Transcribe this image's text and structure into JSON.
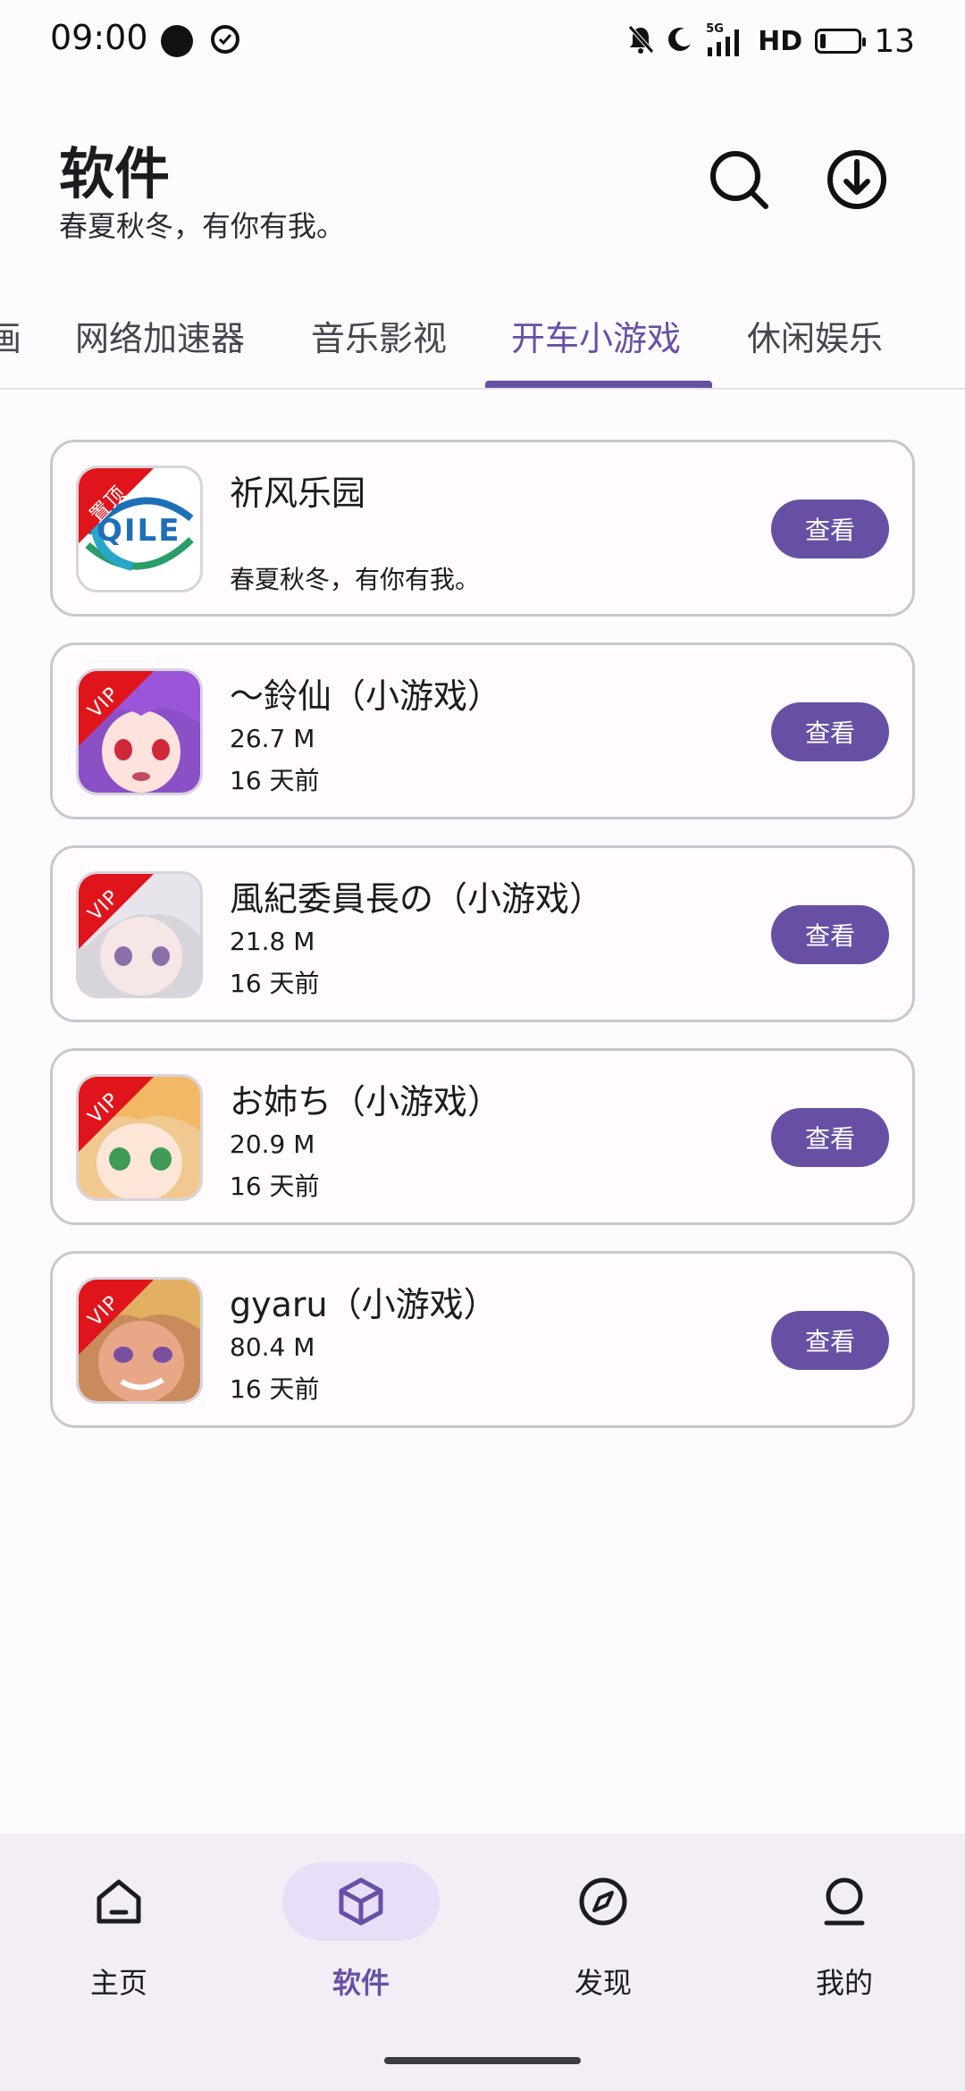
{
  "status_bar": {
    "time": "09:00",
    "network": "5G",
    "hd": "HD",
    "battery": "13",
    "icons": [
      "chat-bubble-icon",
      "check-circle-icon",
      "mute-bell-icon",
      "moon-icon",
      "signal-icon",
      "battery-icon"
    ]
  },
  "header": {
    "title": "软件",
    "subtitle": "春夏秋冬，有你有我。",
    "icons": [
      "search-icon",
      "download-icon"
    ]
  },
  "tabs": [
    {
      "label": "画"
    },
    {
      "label": "网络加速器"
    },
    {
      "label": "音乐影视"
    },
    {
      "label": "开车小游戏",
      "active": true
    },
    {
      "label": "休闲娱乐"
    }
  ],
  "apps": [
    {
      "name": "祈风乐园",
      "desc": "春夏秋冬，有你有我。",
      "badge": "置顶",
      "logo_text": "QILE",
      "action": "查看"
    },
    {
      "name": "〜鈴仙（小游戏）",
      "size": "26.7 M",
      "time": "16 天前",
      "badge": "VIP",
      "action": "查看"
    },
    {
      "name": "風紀委員長の（小游戏）",
      "size": "21.8 M",
      "time": "16 天前",
      "badge": "VIP",
      "action": "查看"
    },
    {
      "name": "お姉ち（小游戏）",
      "size": "20.9 M",
      "time": "16 天前",
      "badge": "VIP",
      "action": "查看"
    },
    {
      "name": "gyaru（小游戏）",
      "size": "80.4 M",
      "time": "16 天前",
      "badge": "VIP",
      "action": "查看"
    }
  ],
  "bottom_nav": [
    {
      "label": "主页",
      "icon": "home-icon"
    },
    {
      "label": "软件",
      "icon": "cube-icon",
      "active": true
    },
    {
      "label": "发现",
      "icon": "compass-icon"
    },
    {
      "label": "我的",
      "icon": "person-icon"
    }
  ],
  "colors": {
    "accent": "#6750a4",
    "accent_container": "#e8def8",
    "ribbon": "#e0141b",
    "card_border": "#c9c6d0",
    "background": "#fefbff"
  }
}
